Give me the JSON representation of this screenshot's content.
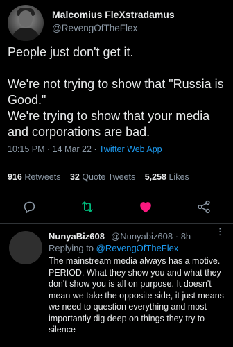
{
  "tweet": {
    "author_name": "Malcomius FleXstradamus",
    "author_handle": "@RevengOfTheFlex",
    "paragraphs": [
      "People just don't get it.",
      "We're not trying to show that \"Russia is Good.\"",
      "We're trying to show that your media and corporations are bad."
    ],
    "time": "10:15 PM",
    "date": "14 Mar 22",
    "source": "Twitter Web App",
    "retweets_count": "916",
    "retweets_label": "Retweets",
    "quote_count": "32",
    "quote_label": "Quote Tweets",
    "likes_count": "5,258",
    "likes_label": "Likes"
  },
  "actions": {
    "reply_icon": "reply-icon",
    "retweet_icon": "retweet-icon",
    "like_icon": "heart-icon",
    "share_icon": "share-icon"
  },
  "reply": {
    "author_name": "NunyaBiz608",
    "author_handle": "@Nunyabiz608",
    "time_ago": "8h",
    "replying_prefix": "Replying to",
    "replying_to": "@RevengOfTheFlex",
    "text": "The mainstream media always has a motive. PERIOD. What they show you and what they don't show you is all on purpose. It doesn't mean we take the opposite side, it just means we need to question everything and most importantly dig deep on things they try to silence"
  },
  "colors": {
    "background": "#000000",
    "text": "#e7e9ea",
    "muted": "#8b98a5",
    "link": "#1d9bf0",
    "retweet": "#00ba7c",
    "like": "#f91880"
  }
}
